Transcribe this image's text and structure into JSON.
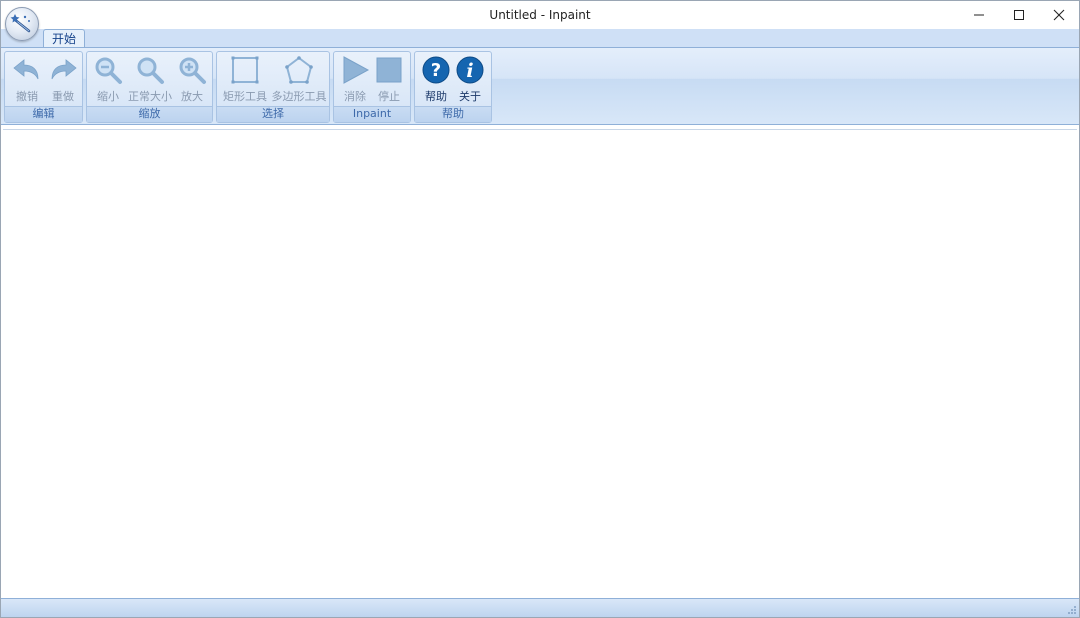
{
  "window": {
    "title": "Untitled - Inpaint"
  },
  "ribbon": {
    "tabs": [
      {
        "label": "开始",
        "active": true
      }
    ],
    "groups": [
      {
        "label": "编辑",
        "buttons": [
          {
            "label": "撤销",
            "icon": "undo-icon",
            "enabled": false
          },
          {
            "label": "重做",
            "icon": "redo-icon",
            "enabled": false
          }
        ]
      },
      {
        "label": "缩放",
        "buttons": [
          {
            "label": "缩小",
            "icon": "zoom-out-icon",
            "enabled": false
          },
          {
            "label": "正常大小",
            "icon": "zoom-normal-icon",
            "enabled": false
          },
          {
            "label": "放大",
            "icon": "zoom-in-icon",
            "enabled": false
          }
        ]
      },
      {
        "label": "选择",
        "buttons": [
          {
            "label": "矩形工具",
            "icon": "rectangle-tool-icon",
            "enabled": false
          },
          {
            "label": "多边形工具",
            "icon": "polygon-tool-icon",
            "enabled": false
          }
        ]
      },
      {
        "label": "Inpaint",
        "buttons": [
          {
            "label": "消除",
            "icon": "play-icon",
            "enabled": false
          },
          {
            "label": "停止",
            "icon": "stop-icon",
            "enabled": false
          }
        ]
      },
      {
        "label": "帮助",
        "buttons": [
          {
            "label": "帮助",
            "icon": "help-icon",
            "enabled": true
          },
          {
            "label": "关于",
            "icon": "info-icon",
            "enabled": true
          }
        ]
      }
    ]
  },
  "colors": {
    "ribbon_bg": "#d6e5f7",
    "disabled_icon": "#8fb3d6",
    "enabled_icon": "#1565b0",
    "group_label": "#3e6aaa"
  }
}
